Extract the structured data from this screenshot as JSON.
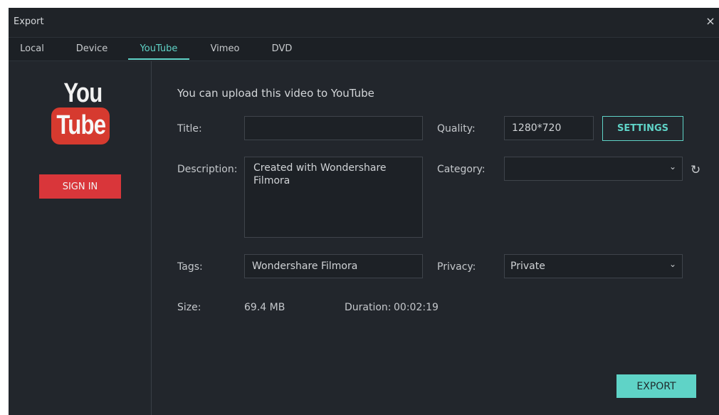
{
  "window": {
    "title": "Export",
    "close_glyph": "×"
  },
  "tabs": [
    {
      "label": "Local"
    },
    {
      "label": "Device"
    },
    {
      "label": "YouTube",
      "active": true
    },
    {
      "label": "Vimeo"
    },
    {
      "label": "DVD"
    }
  ],
  "sidebar": {
    "logo_top": "You",
    "logo_bottom": "Tube",
    "sign_in_label": "SIGN IN"
  },
  "form": {
    "heading": "You can upload this video to YouTube",
    "title_label": "Title:",
    "title_value": "",
    "description_label": "Description:",
    "description_value": "Created with Wondershare Filmora",
    "tags_label": "Tags:",
    "tags_value": "Wondershare Filmora",
    "quality_label": "Quality:",
    "quality_value": "1280*720",
    "settings_label": "SETTINGS",
    "category_label": "Category:",
    "category_value": "",
    "privacy_label": "Privacy:",
    "privacy_value": "Private",
    "size_label": "Size:",
    "size_value": "69.4 MB",
    "duration_label": "Duration:",
    "duration_value": "00:02:19"
  },
  "export_label": "EXPORT",
  "icons": {
    "chevron": "⌄",
    "refresh": "↻"
  },
  "colors": {
    "accent": "#5fd3c7",
    "sign_in": "#d9363a",
    "youtube_red": "#d63a2f",
    "background": "#22262c"
  }
}
